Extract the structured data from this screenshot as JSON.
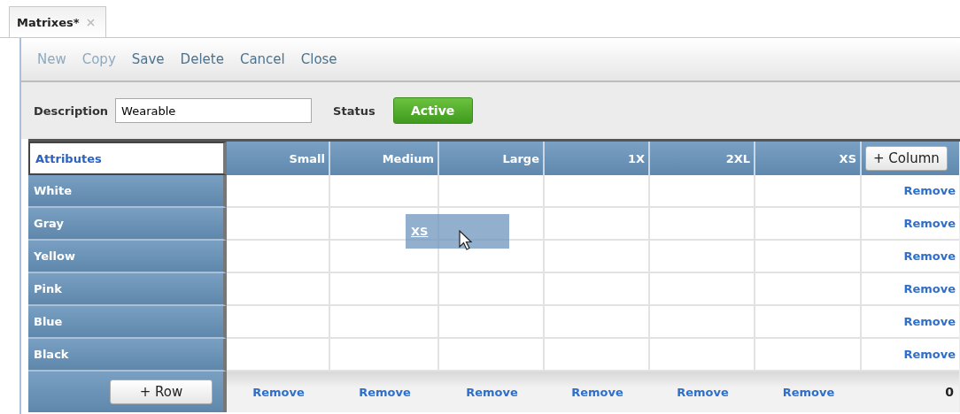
{
  "tab": {
    "label": "Matrixes*"
  },
  "toolbar": [
    {
      "label": "New",
      "disabled": true
    },
    {
      "label": "Copy",
      "disabled": true
    },
    {
      "label": "Save",
      "disabled": false
    },
    {
      "label": "Delete",
      "disabled": false
    },
    {
      "label": "Cancel",
      "disabled": false
    },
    {
      "label": "Close",
      "disabled": false
    }
  ],
  "description": {
    "label": "Description",
    "value": "Wearable"
  },
  "status": {
    "label": "Status",
    "value": "Active"
  },
  "grid": {
    "corner": "Attributes",
    "columns": [
      "Small",
      "Medium",
      "Large",
      "1X",
      "2XL",
      "XS"
    ],
    "add_column": "+ Column",
    "rows": [
      {
        "label": "White",
        "action": "Remove"
      },
      {
        "label": "Gray",
        "action": "Remove"
      },
      {
        "label": "Yellow",
        "action": "Remove"
      },
      {
        "label": "Pink",
        "action": "Remove"
      },
      {
        "label": "Blue",
        "action": "Remove"
      },
      {
        "label": "Black",
        "action": "Remove"
      }
    ],
    "add_row": "+ Row",
    "footer_actions": [
      "Remove",
      "Remove",
      "Remove",
      "Remove",
      "Remove",
      "Remove"
    ],
    "count": "0"
  },
  "drag_ghost": {
    "label": "XS"
  }
}
